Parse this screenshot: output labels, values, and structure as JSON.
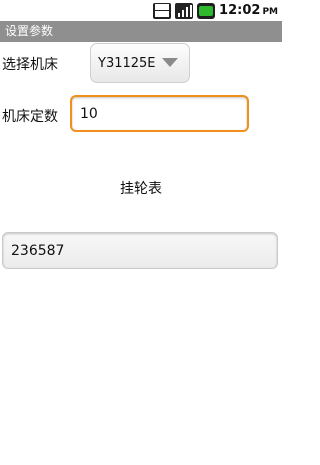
{
  "status": {
    "time": "12:02",
    "ampm": "PM",
    "network": "3G"
  },
  "title_bar": {
    "title": "设置参数"
  },
  "form": {
    "machine_label": "选择机床",
    "machine_selected": "Y31125E",
    "constant_label": "机床定数",
    "constant_value": "10",
    "gear_table_label": "挂轮表",
    "result_value": "236587"
  }
}
